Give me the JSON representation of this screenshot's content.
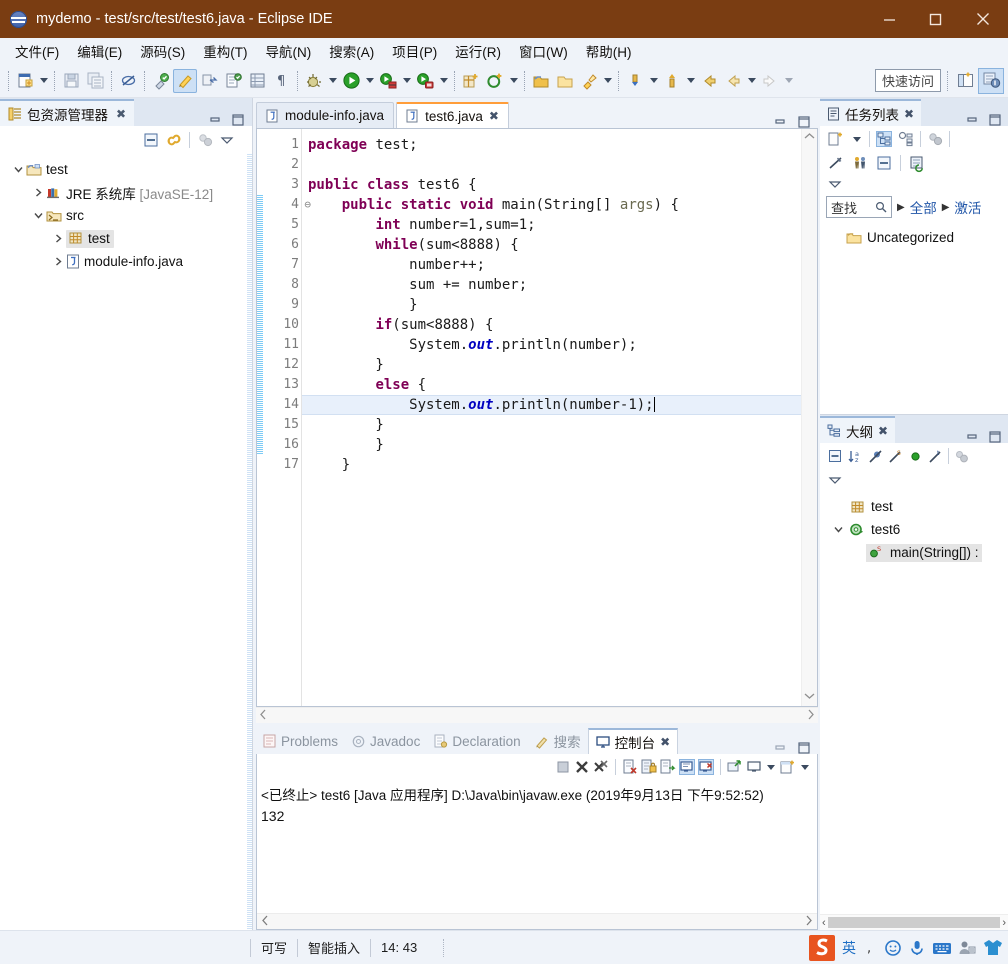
{
  "window": {
    "title": "mydemo - test/src/test/test6.java - Eclipse IDE",
    "titlebar_bg": "#7a3d12",
    "minimize": "—",
    "maximize": "☐",
    "close": "✕"
  },
  "menubar": {
    "items": [
      {
        "label": "文件(F)",
        "mnemonic": "F"
      },
      {
        "label": "编辑(E)",
        "mnemonic": "E"
      },
      {
        "label": "源码(S)",
        "mnemonic": "S"
      },
      {
        "label": "重构(T)",
        "mnemonic": "T"
      },
      {
        "label": "导航(N)",
        "mnemonic": "N"
      },
      {
        "label": "搜索(A)",
        "mnemonic": "A"
      },
      {
        "label": "项目(P)",
        "mnemonic": "P"
      },
      {
        "label": "运行(R)",
        "mnemonic": "R"
      },
      {
        "label": "窗口(W)",
        "mnemonic": "W"
      },
      {
        "label": "帮助(H)",
        "mnemonic": "H"
      }
    ]
  },
  "toolbar": {
    "quick_access_placeholder": "快速访问",
    "icons": [
      "new-wizard-icon",
      "save-icon",
      "save-all-icon",
      "toggle-breakpoint-icon",
      "toggle-mark-occurrences-icon",
      "external-tools-icon",
      "open-type-icon",
      "new-java-package-icon",
      "new-class-icon",
      "paragraph-mark-icon",
      "debug-icon",
      "run-icon",
      "run-last-tool-icon",
      "profile-icon",
      "new-java-project-icon",
      "new-annotation-icon",
      "open-task-icon",
      "open-folder-icon",
      "pin-icon",
      "previous-annotation-icon",
      "next-annotation-icon",
      "back-icon",
      "forward-icon",
      "next-edit-icon"
    ],
    "perspective_icons": [
      "open-perspective-icon",
      "java-perspective-icon"
    ]
  },
  "package_explorer": {
    "tab_label": "包资源管理器",
    "tab_icon": "package-explorer-icon",
    "close_label": "✖",
    "toolbar_icons": [
      "collapse-all-icon",
      "link-with-editor-icon",
      "focus-on-active-task-icon",
      "view-menu-icon"
    ],
    "tree": [
      {
        "label": "test",
        "icon": "java-project-icon",
        "depth": 0,
        "twisty": "open",
        "selected": false,
        "dim": ""
      },
      {
        "label": "JRE 系统库",
        "icon": "jre-library-icon",
        "depth": 1,
        "twisty": "closed",
        "selected": false,
        "dim": "[JavaSE-12]"
      },
      {
        "label": "src",
        "icon": "source-folder-icon",
        "depth": 1,
        "twisty": "open",
        "selected": false,
        "dim": ""
      },
      {
        "label": "test",
        "icon": "package-icon",
        "depth": 2,
        "twisty": "closed",
        "selected": true,
        "dim": ""
      },
      {
        "label": "module-info.java",
        "icon": "java-file-icon",
        "depth": 2,
        "twisty": "closed",
        "selected": false,
        "dim": ""
      }
    ]
  },
  "editor": {
    "tabs": [
      {
        "label": "module-info.java",
        "icon": "java-file-icon",
        "active": false,
        "closeable": false
      },
      {
        "label": "test6.java",
        "icon": "java-file-icon",
        "active": true,
        "closeable": true,
        "close_label": "✖"
      }
    ],
    "ctrl_min": "➖",
    "ctrl_max": "☐",
    "current_line": 14,
    "lines": [
      {
        "n": 1,
        "deco": false,
        "changed": false,
        "tokens": [
          {
            "t": "package ",
            "c": "kw"
          },
          {
            "t": "test;",
            "c": ""
          }
        ]
      },
      {
        "n": 2,
        "deco": false,
        "changed": false,
        "tokens": []
      },
      {
        "n": 3,
        "deco": false,
        "changed": false,
        "tokens": [
          {
            "t": "public class ",
            "c": "kw"
          },
          {
            "t": "test6 {",
            "c": ""
          }
        ]
      },
      {
        "n": 4,
        "deco": true,
        "changed": true,
        "tokens": [
          {
            "t": "    ",
            "c": ""
          },
          {
            "t": "public static void ",
            "c": "kw"
          },
          {
            "t": "main(String[] ",
            "c": ""
          },
          {
            "t": "args",
            "c": "par"
          },
          {
            "t": ") {",
            "c": ""
          }
        ]
      },
      {
        "n": 5,
        "deco": false,
        "changed": true,
        "tokens": [
          {
            "t": "        ",
            "c": ""
          },
          {
            "t": "int ",
            "c": "kw"
          },
          {
            "t": "number=1,sum=1;",
            "c": ""
          }
        ]
      },
      {
        "n": 6,
        "deco": false,
        "changed": true,
        "tokens": [
          {
            "t": "        ",
            "c": ""
          },
          {
            "t": "while",
            "c": "kw"
          },
          {
            "t": "(sum<8888) {",
            "c": ""
          }
        ]
      },
      {
        "n": 7,
        "deco": false,
        "changed": true,
        "tokens": [
          {
            "t": "            number++;",
            "c": ""
          }
        ]
      },
      {
        "n": 8,
        "deco": false,
        "changed": true,
        "tokens": [
          {
            "t": "            sum += number;",
            "c": ""
          }
        ]
      },
      {
        "n": 9,
        "deco": false,
        "changed": true,
        "tokens": [
          {
            "t": "            }",
            "c": ""
          }
        ]
      },
      {
        "n": 10,
        "deco": false,
        "changed": true,
        "tokens": [
          {
            "t": "        ",
            "c": ""
          },
          {
            "t": "if",
            "c": "kw"
          },
          {
            "t": "(sum<8888) {",
            "c": ""
          }
        ]
      },
      {
        "n": 11,
        "deco": false,
        "changed": true,
        "tokens": [
          {
            "t": "            System.",
            "c": ""
          },
          {
            "t": "out",
            "c": "fld"
          },
          {
            "t": ".println(number);",
            "c": ""
          }
        ]
      },
      {
        "n": 12,
        "deco": false,
        "changed": true,
        "tokens": [
          {
            "t": "        }",
            "c": ""
          }
        ]
      },
      {
        "n": 13,
        "deco": false,
        "changed": true,
        "tokens": [
          {
            "t": "        ",
            "c": ""
          },
          {
            "t": "else ",
            "c": "kw"
          },
          {
            "t": "{",
            "c": ""
          }
        ]
      },
      {
        "n": 14,
        "deco": false,
        "changed": true,
        "tokens": [
          {
            "t": "            System.",
            "c": ""
          },
          {
            "t": "out",
            "c": "fld"
          },
          {
            "t": ".println(number-1);",
            "c": ""
          }
        ]
      },
      {
        "n": 15,
        "deco": false,
        "changed": true,
        "tokens": [
          {
            "t": "        }",
            "c": ""
          }
        ]
      },
      {
        "n": 16,
        "deco": false,
        "changed": true,
        "tokens": [
          {
            "t": "        }",
            "c": ""
          }
        ]
      },
      {
        "n": 17,
        "deco": false,
        "changed": false,
        "tokens": [
          {
            "t": "    }",
            "c": ""
          }
        ]
      }
    ]
  },
  "task_list": {
    "tab_label": "任务列表",
    "tab_icon": "task-list-icon",
    "close_label": "✖",
    "toolbar_icons": [
      "new-task-icon",
      "new-task-menu-icon",
      "categorized-icon",
      "scheduled-icon",
      "synchronize-icon"
    ],
    "toolbar2_icons": [
      "focus-on-workweek-icon",
      "show-all-icon",
      "collapse-all-icon",
      "restore-tasks-icon"
    ],
    "view_menu_icon": "view-menu-icon",
    "find_placeholder": "查找",
    "find_icon": "search-icon",
    "presets": [
      "全部",
      "激活"
    ],
    "items": [
      {
        "label": "Uncategorized",
        "icon": "category-folder-icon"
      }
    ]
  },
  "outline": {
    "tab_label": "大纲",
    "tab_icon": "outline-icon",
    "close_label": "✖",
    "toolbar_icons": [
      "collapse-all-icon",
      "sort-icon",
      "hide-fields-icon",
      "hide-static-icon",
      "hide-nonpublic-icon",
      "hide-local-types-icon",
      "focus-icon"
    ],
    "view_menu_icon": "view-menu-icon",
    "items": [
      {
        "label": "test",
        "icon": "package-icon",
        "depth": 1,
        "twisty": "none",
        "selected": false
      },
      {
        "label": "test6",
        "icon": "class-icon",
        "depth": 0,
        "twisty": "open",
        "selected": false
      },
      {
        "label": "main(String[]) :",
        "icon": "method-public-static-icon",
        "depth": 2,
        "twisty": "none",
        "selected": true
      }
    ],
    "hscroll": {
      "left": "‹",
      "right": "›"
    }
  },
  "console_panel": {
    "tabs": [
      {
        "label": "Problems",
        "icon": "problems-icon",
        "active": false
      },
      {
        "label": "Javadoc",
        "icon": "javadoc-icon",
        "active": false
      },
      {
        "label": "Declaration",
        "icon": "declaration-icon",
        "active": false
      },
      {
        "label": "搜索",
        "icon": "search-view-icon",
        "active": false
      },
      {
        "label": "控制台",
        "icon": "console-icon",
        "active": true,
        "close_label": "✖"
      }
    ],
    "ctrl_min": "➖",
    "ctrl_max": "☐",
    "toolbar_icons": [
      "terminate-icon",
      "remove-launch-icon",
      "remove-all-launches-icon",
      "clear-console-icon",
      "scroll-lock-icon",
      "word-wrap-icon",
      "show-console-on-output-icon",
      "show-console-on-error-icon",
      "pin-console-icon",
      "display-selected-console-icon",
      "display-selected-console-menu-icon",
      "open-console-icon",
      "open-console-menu-icon"
    ],
    "header_line": "<已终止> test6 [Java 应用程序] D:\\Java\\bin\\javaw.exe  (2019年9月13日 下午9:52:52)",
    "output": "132",
    "hscroll": {
      "left": "‹",
      "right": "›"
    }
  },
  "statusbar": {
    "writable": "可写",
    "insert_mode": "智能插入",
    "cursor_position": "14: 43",
    "tray_icons": [
      "sogou-logo-icon",
      "ime-chinese-icon",
      "ime-punctuation-icon",
      "ime-emoji-icon",
      "ime-voice-icon",
      "ime-keyboard-icon",
      "ime-user-icon",
      "ime-skin-icon"
    ]
  }
}
